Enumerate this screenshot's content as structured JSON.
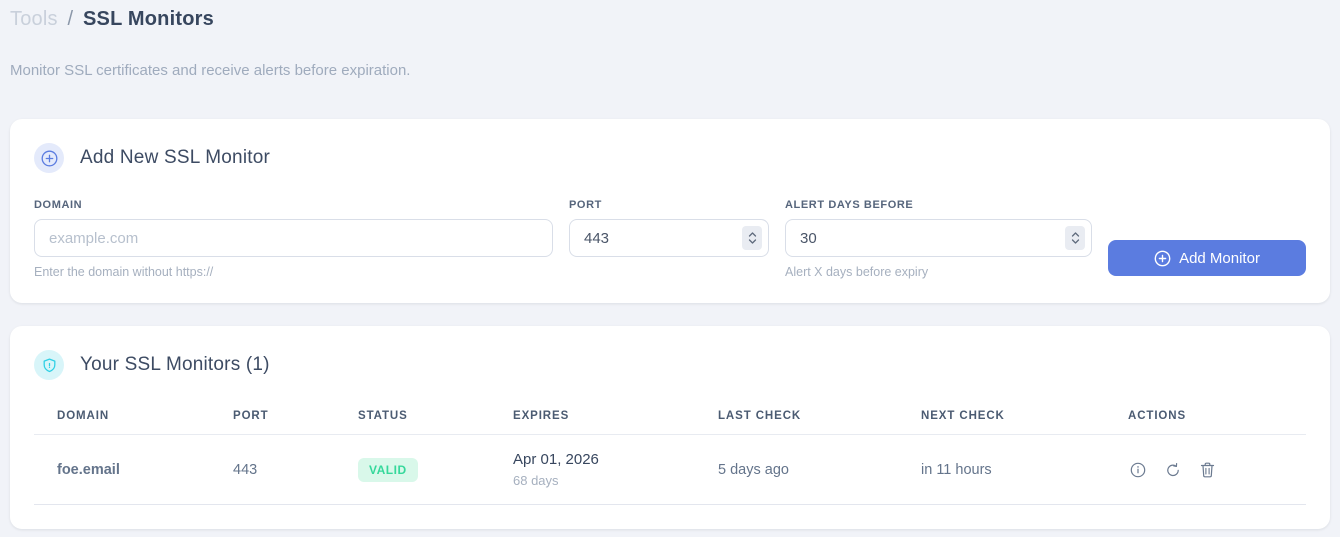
{
  "breadcrumb": {
    "section": "Tools",
    "separator": "/",
    "current": "SSL Monitors"
  },
  "subtitle": "Monitor SSL certificates and receive alerts before expiration.",
  "add_card": {
    "title": "Add New SSL Monitor",
    "fields": {
      "domain": {
        "label": "DOMAIN",
        "placeholder": "example.com",
        "helper": "Enter the domain without https://"
      },
      "port": {
        "label": "PORT",
        "value": "443"
      },
      "alert_days": {
        "label": "ALERT DAYS BEFORE",
        "value": "30",
        "helper": "Alert X days before expiry"
      }
    },
    "submit_label": "Add Monitor"
  },
  "monitors_card": {
    "title": "Your SSL Monitors (1)",
    "columns": [
      "DOMAIN",
      "PORT",
      "STATUS",
      "EXPIRES",
      "LAST CHECK",
      "NEXT CHECK",
      "ACTIONS"
    ],
    "rows": [
      {
        "domain": "foe.email",
        "port": "443",
        "status": "VALID",
        "expires_date": "Apr 01, 2026",
        "expires_days": "68 days",
        "last_check": "5 days ago",
        "next_check": "in 11 hours"
      }
    ]
  },
  "colors": {
    "accent_blue": "#5b7ce0",
    "accent_cyan": "#2fd0e4",
    "status_valid_text": "#35d89b",
    "status_valid_bg": "#d9f8ea",
    "page_bg": "#f1f3f8"
  }
}
